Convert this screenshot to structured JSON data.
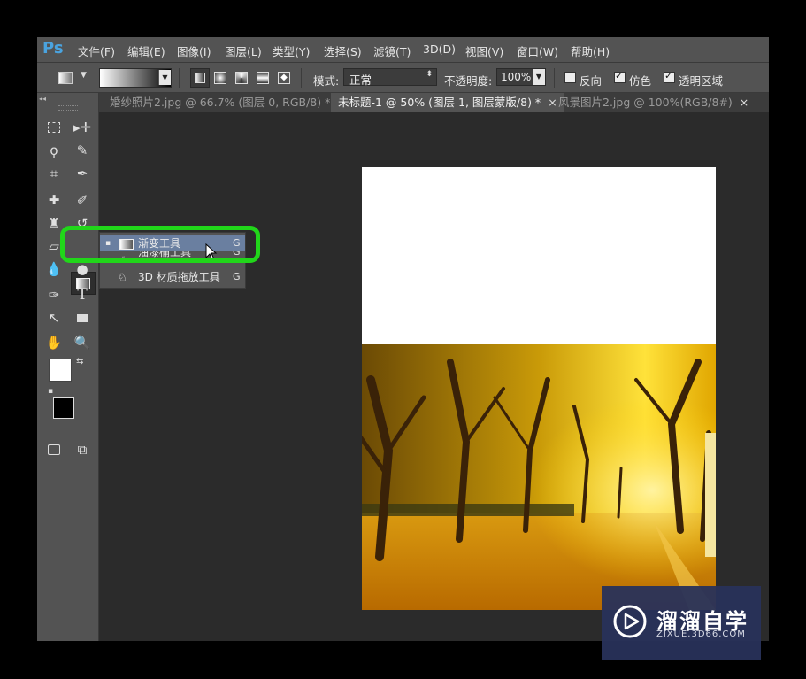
{
  "app": {
    "logo": "Ps",
    "menu": [
      "文件(F)",
      "编辑(E)",
      "图像(I)",
      "图层(L)",
      "类型(Y)",
      "选择(S)",
      "滤镜(T)",
      "3D(D)",
      "视图(V)",
      "窗口(W)",
      "帮助(H)"
    ]
  },
  "options": {
    "mode_label": "模式:",
    "mode_value": "正常",
    "opacity_label": "不透明度:",
    "opacity_value": "100%",
    "reverse_label": "反向",
    "dither_label": "仿色",
    "transparency_label": "透明区域",
    "reverse_checked": false,
    "dither_checked": true,
    "transparency_checked": true
  },
  "tabs": [
    {
      "label": "婚纱照片2.jpg @ 66.7% (图层 0, RGB/8) *",
      "active": false,
      "close": "×"
    },
    {
      "label": "未标题-1 @ 50% (图层 1, 图层蒙版/8) *",
      "active": true,
      "close": "×"
    },
    {
      "label": "风景图片2.jpg @ 100%(RGB/8#)",
      "active": false,
      "close": "×"
    }
  ],
  "flyout": {
    "items": [
      {
        "label": "渐变工具",
        "key": "G",
        "selected": true
      },
      {
        "label": "油漆桶工具",
        "key": "G",
        "selected": false
      },
      {
        "label": "3D 材质拖放工具",
        "key": "G",
        "selected": false
      }
    ]
  },
  "watermark": {
    "title": "溜溜自学",
    "url": "ZIXUE.3D66.COM"
  },
  "colors": {
    "accent_highlight": "#21d61a",
    "ps_blue": "#4aa3df",
    "panel": "#535353",
    "workspace": "#2b2b2b"
  }
}
